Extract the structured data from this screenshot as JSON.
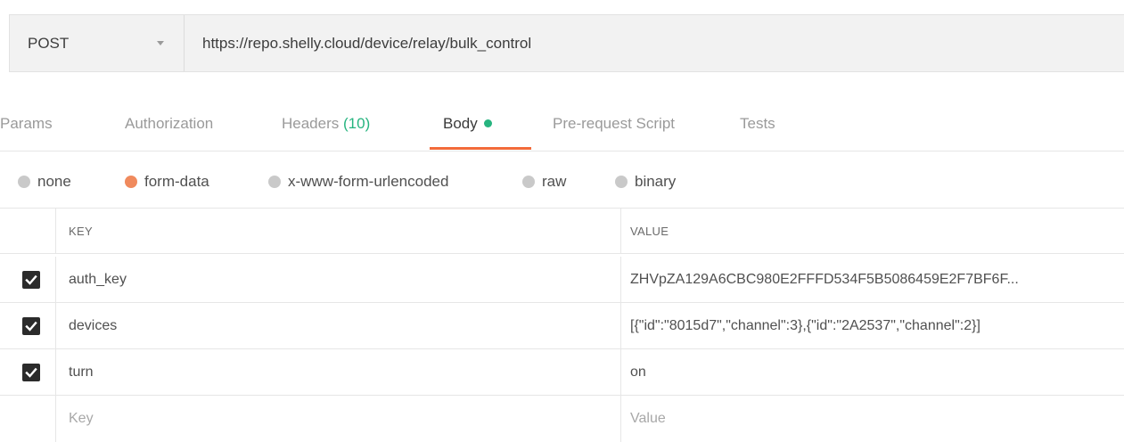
{
  "request": {
    "method": "POST",
    "url": "https://repo.shelly.cloud/device/relay/bulk_control"
  },
  "tabs": [
    {
      "label": "Params"
    },
    {
      "label": "Authorization"
    },
    {
      "label": "Headers",
      "count": "(10)"
    },
    {
      "label": "Body",
      "active": true
    },
    {
      "label": "Pre-request Script"
    },
    {
      "label": "Tests"
    }
  ],
  "body_types": [
    {
      "label": "none",
      "selected": false
    },
    {
      "label": "form-data",
      "selected": true
    },
    {
      "label": "x-www-form-urlencoded",
      "selected": false
    },
    {
      "label": "raw",
      "selected": false
    },
    {
      "label": "binary",
      "selected": false
    }
  ],
  "table": {
    "headers": {
      "key": "KEY",
      "value": "VALUE"
    },
    "rows": [
      {
        "checked": true,
        "key": "auth_key",
        "value": "ZHVpZA129A6CBC980E2FFFD534F5B5086459E2F7BF6F..."
      },
      {
        "checked": true,
        "key": "devices",
        "value": "[{\"id\":\"8015d7\",\"channel\":3},{\"id\":\"2A2537\",\"channel\":2}]"
      },
      {
        "checked": true,
        "key": "turn",
        "value": "on"
      }
    ],
    "placeholder": {
      "key": "Key",
      "value": "Value"
    }
  },
  "colors": {
    "accent": "#f26b3a",
    "success": "#26b47f",
    "radio_selected": "#f08a5d"
  }
}
